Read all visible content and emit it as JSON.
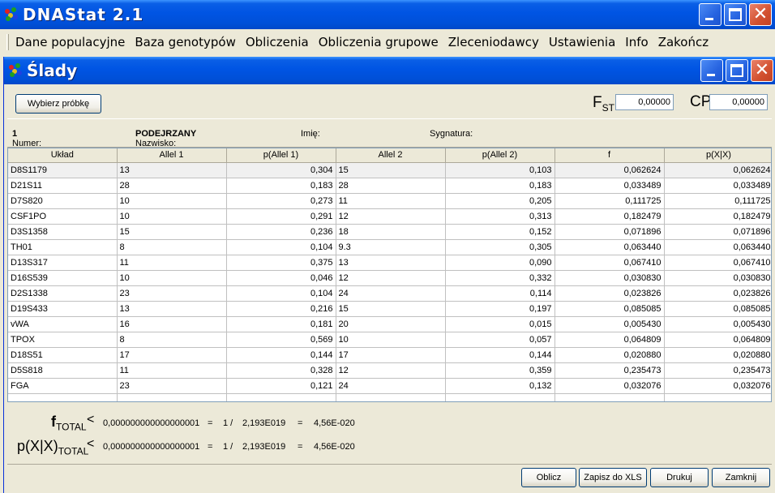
{
  "app": {
    "title": "DNAStat  2.1"
  },
  "menu": [
    {
      "label": "Dane populacyjne"
    },
    {
      "label": "Baza genotypów"
    },
    {
      "label": "Obliczenia"
    },
    {
      "label": "Obliczenia grupowe"
    },
    {
      "label": "Zleceniodawcy"
    },
    {
      "label": "Ustawienia"
    },
    {
      "label": "Info"
    },
    {
      "label": "Zakończ"
    }
  ],
  "child": {
    "title": "Ślady"
  },
  "toolbar": {
    "select_sample": "Wybierz próbkę",
    "fst_label": "F",
    "fst_sub": "ST",
    "fst_value": "0,00000",
    "cp_label": "CP",
    "cp_value": "0,00000"
  },
  "info": {
    "number_label": "Numer:",
    "number_value": "1",
    "surname_label": "Nazwisko:",
    "surname_value": "PODEJRZANY",
    "name_label": "Imię:",
    "signature_label": "Sygnatura:"
  },
  "table": {
    "columns": [
      "Układ",
      "Allel 1",
      "p(Allel 1)",
      "Allel 2",
      "p(Allel 2)",
      "f",
      "p(X|X)"
    ],
    "rows": [
      [
        "D8S1179",
        "13",
        "0,304",
        "15",
        "0,103",
        "0,062624",
        "0,062624"
      ],
      [
        "D21S11",
        "28",
        "0,183",
        "28",
        "0,183",
        "0,033489",
        "0,033489"
      ],
      [
        "D7S820",
        "10",
        "0,273",
        "11",
        "0,205",
        "0,111725",
        "0,111725"
      ],
      [
        "CSF1PO",
        "10",
        "0,291",
        "12",
        "0,313",
        "0,182479",
        "0,182479"
      ],
      [
        "D3S1358",
        "15",
        "0,236",
        "18",
        "0,152",
        "0,071896",
        "0,071896"
      ],
      [
        "TH01",
        "8",
        "0,104",
        "9.3",
        "0,305",
        "0,063440",
        "0,063440"
      ],
      [
        "D13S317",
        "11",
        "0,375",
        "13",
        "0,090",
        "0,067410",
        "0,067410"
      ],
      [
        "D16S539",
        "10",
        "0,046",
        "12",
        "0,332",
        "0,030830",
        "0,030830"
      ],
      [
        "D2S1338",
        "23",
        "0,104",
        "24",
        "0,114",
        "0,023826",
        "0,023826"
      ],
      [
        "D19S433",
        "13",
        "0,216",
        "15",
        "0,197",
        "0,085085",
        "0,085085"
      ],
      [
        "vWA",
        "16",
        "0,181",
        "20",
        "0,015",
        "0,005430",
        "0,005430"
      ],
      [
        "TPOX",
        "8",
        "0,569",
        "10",
        "0,057",
        "0,064809",
        "0,064809"
      ],
      [
        "D18S51",
        "17",
        "0,144",
        "17",
        "0,144",
        "0,020880",
        "0,020880"
      ],
      [
        "D5S818",
        "11",
        "0,328",
        "12",
        "0,359",
        "0,235473",
        "0,235473"
      ],
      [
        "FGA",
        "23",
        "0,121",
        "24",
        "0,132",
        "0,032076",
        "0,032076"
      ]
    ]
  },
  "totals": {
    "f_label": "f",
    "f_sub": "TOTAL",
    "f_lt": "<",
    "f_value": "0,000000000000000001",
    "f_eq1": "=",
    "f_ratio": "1 /",
    "f_denominator": "2,193E019",
    "f_eq2": "=",
    "f_result": "4,56E-020",
    "p_label": "p(X|X)",
    "p_sub": "TOTAL",
    "p_lt": "<",
    "p_value": "0,000000000000000001",
    "p_eq1": "=",
    "p_ratio": "1 /",
    "p_denominator": "2,193E019",
    "p_eq2": "=",
    "p_result": "4,56E-020"
  },
  "buttons": {
    "calculate": "Oblicz",
    "save_xls": "Zapisz do XLS",
    "print": "Drukuj",
    "close": "Zamknij"
  }
}
